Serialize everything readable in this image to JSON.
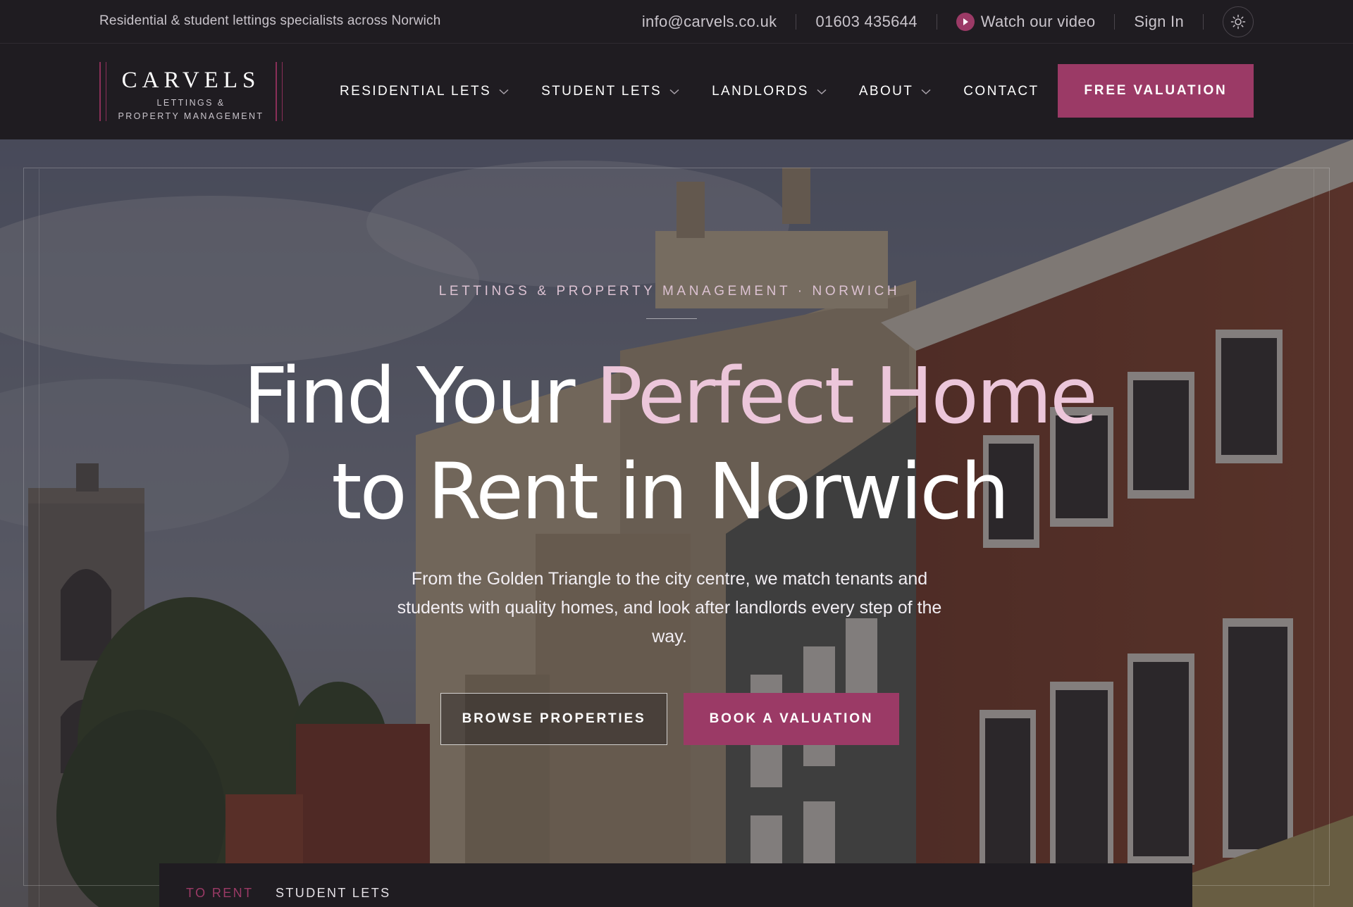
{
  "topbar": {
    "tagline": "Residential & student lettings specialists across Norwich",
    "email": "info@carvels.co.uk",
    "phone": "01603 435644",
    "video_label": "Watch our video",
    "signin_label": "Sign In",
    "theme_icon": "sun-icon"
  },
  "header": {
    "logo": {
      "brand": "CARVELS",
      "sub_line1": "LETTINGS &",
      "sub_line2": "PROPERTY MANAGEMENT"
    },
    "nav": [
      {
        "label": "RESIDENTIAL LETS",
        "has_dropdown": true
      },
      {
        "label": "STUDENT LETS",
        "has_dropdown": true
      },
      {
        "label": "LANDLORDS",
        "has_dropdown": true
      },
      {
        "label": "ABOUT",
        "has_dropdown": true
      },
      {
        "label": "CONTACT",
        "has_dropdown": false
      }
    ],
    "cta_label": "FREE VALUATION"
  },
  "hero": {
    "eyebrow": "LETTINGS & PROPERTY MANAGEMENT · NORWICH",
    "headline_part1": "Find Your ",
    "headline_accent": "Perfect Home",
    "headline_part2": "to Rent in Norwich",
    "lede": "From the Golden Triangle to the city centre, we match tenants and students with quality homes, and look after landlords every step of the way.",
    "primary_button": "BROWSE PROPERTIES",
    "secondary_button": "BOOK A VALUATION"
  },
  "search": {
    "tabs": [
      {
        "label": "TO RENT",
        "active": true
      },
      {
        "label": "STUDENT LETS",
        "active": false
      }
    ]
  },
  "colors": {
    "brand": "#9b3a66",
    "accent_text": "#ecc6da",
    "background": "#1f1c21"
  }
}
